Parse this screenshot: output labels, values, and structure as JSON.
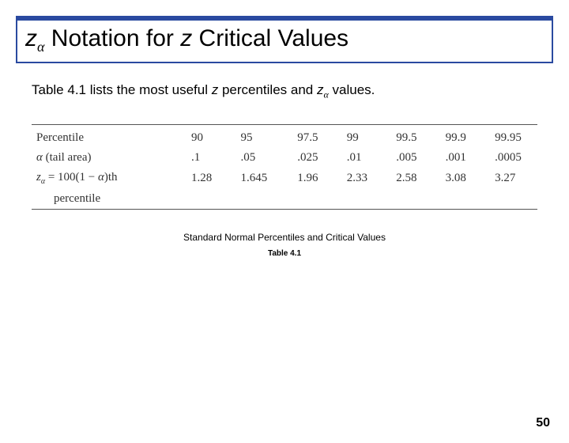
{
  "title": {
    "z": "z",
    "alpha": "α",
    "text1": " Notation for ",
    "z2": "z",
    "text2": " Critical Values"
  },
  "intro": {
    "pre": "Table 4.1 lists the most useful ",
    "z": "z",
    "mid": " percentiles and ",
    "z2": "z",
    "alpha": "α",
    "post": " values."
  },
  "table": {
    "row_labels": {
      "percentile": "Percentile",
      "alpha_label_pre": "α",
      "alpha_label_post": " (tail area)",
      "z_label_pre": "z",
      "z_label_sub": "α",
      "z_label_mid": " = 100(1 − ",
      "z_label_sub2": "α",
      "z_label_post": ")th",
      "z_label_line2": "percentile"
    },
    "percentile": [
      "90",
      "95",
      "97.5",
      "99",
      "99.5",
      "99.9",
      "99.95"
    ],
    "alpha": [
      ".1",
      ".05",
      ".025",
      ".01",
      ".005",
      ".001",
      ".0005"
    ],
    "z": [
      "1.28",
      "1.645",
      "1.96",
      "2.33",
      "2.58",
      "3.08",
      "3.27"
    ]
  },
  "caption1": "Standard Normal Percentiles and Critical Values",
  "caption2": "Table 4.1",
  "pagenum": "50"
}
